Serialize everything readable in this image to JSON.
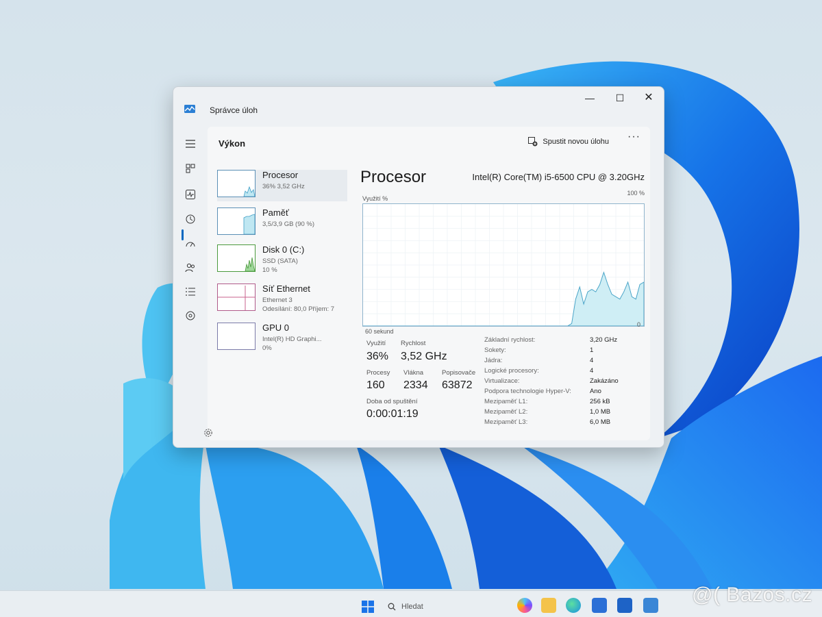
{
  "window": {
    "title": "Správce úloh",
    "min_symbol": "—",
    "max_symbol": "☐",
    "close_symbol": "✕"
  },
  "header": {
    "page_title": "Výkon",
    "run_task_label": "Spustit novou úlohu",
    "more_label": "···"
  },
  "nav": {
    "icons": [
      "hamburger-menu-icon",
      "processes-icon",
      "performance-icon",
      "app-history-icon",
      "startup-apps-icon",
      "users-icon",
      "details-icon",
      "services-icon",
      "settings-icon"
    ],
    "selected": "performance-icon"
  },
  "devices": [
    {
      "name": "Procesor",
      "sub1": "36% 3,52 GHz",
      "sub2": ""
    },
    {
      "name": "Paměť",
      "sub1": "3,5/3,9 GB (90 %)",
      "sub2": ""
    },
    {
      "name": "Disk 0 (C:)",
      "sub1": "SSD (SATA)",
      "sub2": "10 %"
    },
    {
      "name": "Síť Ethernet",
      "sub1": "Ethernet 3",
      "sub2": "Odesílání: 80,0 Příjem: 7"
    },
    {
      "name": "GPU 0",
      "sub1": "Intel(R) HD Graphi...",
      "sub2": "0%"
    }
  ],
  "detail": {
    "title": "Procesor",
    "model": "Intel(R) Core(TM) i5-6500 CPU @ 3.20GHz",
    "graph_label_left": "Využití %",
    "graph_label_right": "100 %",
    "graph_bottom_left": "60 sekund",
    "graph_bottom_right": "0",
    "graph_utilization": [
      0,
      0,
      0,
      0,
      0,
      0,
      0,
      0,
      0,
      0,
      0,
      0,
      0,
      0,
      0,
      0,
      0,
      0,
      0,
      0,
      0,
      0,
      0,
      0,
      0,
      0,
      0,
      0,
      0,
      0,
      0,
      0,
      0,
      0,
      0,
      0,
      0,
      0,
      0,
      0,
      0,
      0,
      0,
      0,
      0,
      0,
      0,
      0,
      0,
      0,
      0,
      0,
      2,
      22,
      32,
      18,
      28,
      30,
      28,
      34,
      44,
      34,
      26,
      24,
      22,
      28,
      36,
      24,
      22,
      34,
      36
    ]
  },
  "stats": {
    "utilization_label": "Využití",
    "utilization_value": "36%",
    "speed_label": "Rychlost",
    "speed_value": "3,52 GHz",
    "processes_label": "Procesy",
    "processes_value": "160",
    "threads_label": "Vlákna",
    "threads_value": "2334",
    "handles_label": "Popisovače",
    "handles_value": "63872",
    "uptime_label": "Doba od spuštění",
    "uptime_value": "0:00:01:19"
  },
  "specs": [
    {
      "label": "Základní rychlost:",
      "value": "3,20 GHz"
    },
    {
      "label": "Sokety:",
      "value": "1"
    },
    {
      "label": "Jádra:",
      "value": "4"
    },
    {
      "label": "Logické procesory:",
      "value": "4"
    },
    {
      "label": "Virtualizace:",
      "value": "Zakázáno"
    },
    {
      "label": "Podpora technologie Hyper-V:",
      "value": "Ano"
    },
    {
      "label": "Mezipaměť L1:",
      "value": "256 kB"
    },
    {
      "label": "Mezipaměť L2:",
      "value": "1,0 MB"
    },
    {
      "label": "Mezipaměť L3:",
      "value": "6,0 MB"
    }
  ],
  "taskbar": {
    "search_placeholder": "Hledat",
    "apps": [
      "copilot-icon",
      "file-explorer-icon",
      "edge-icon",
      "store-icon",
      "outlook-icon",
      "task-manager-icon"
    ]
  },
  "watermark": "@( Bazos.cz",
  "colors": {
    "accent": "#0067c0",
    "graph_fill": "#cfeef5",
    "graph_line": "#4aa5c8"
  }
}
